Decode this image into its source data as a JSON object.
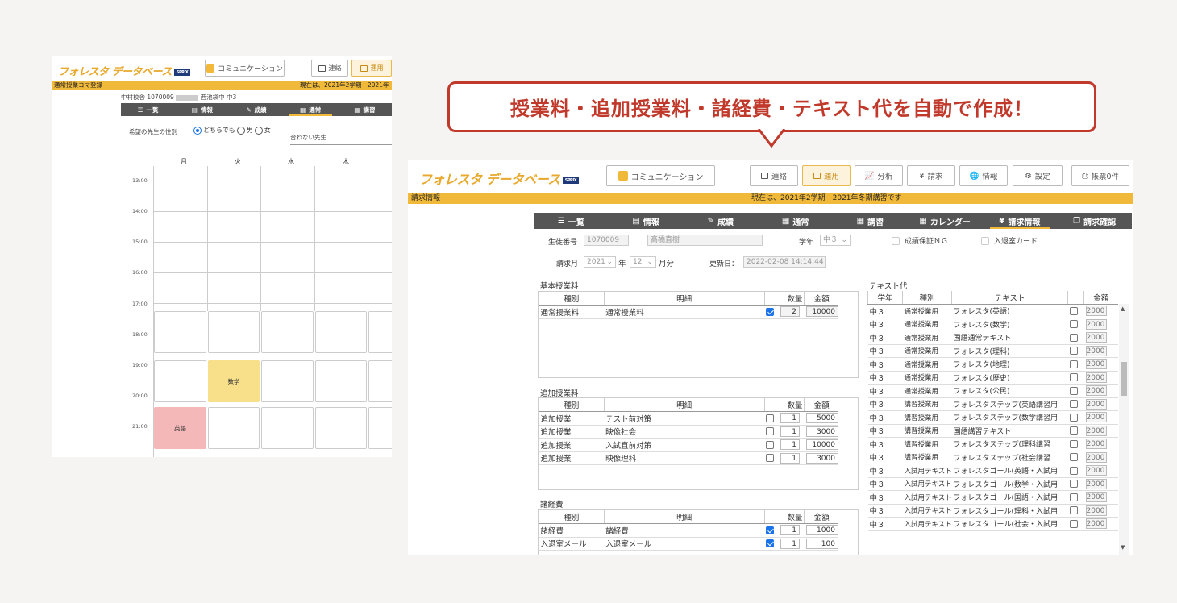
{
  "callout": {
    "text": "授業料・追加授業料・諸経費・テキスト代を自動で作成！"
  },
  "left": {
    "logo": "フォレスタ データベース",
    "sprix": "SPRIX",
    "comm_button": "コミュニケーション",
    "btn_contact": "連絡",
    "btn_ops": "運用",
    "bar_title": "通常授業コマ登録",
    "bar_status": "現在は、2021年2学期　2021年",
    "student_line_a": "中村校舎 1070009",
    "student_line_b": "西池袋中 中3",
    "nav": [
      "一覧",
      "情報",
      "成績",
      "通常",
      "講習"
    ],
    "pref_label": "希望の先生の性別",
    "pref_options": [
      "どちらでも",
      "男",
      "女"
    ],
    "ng_label": "合わない先生",
    "days": [
      "月",
      "火",
      "水",
      "木"
    ],
    "times": [
      "13:00",
      "14:00",
      "15:00",
      "16:00",
      "17:00",
      "18:00",
      "19:00",
      "20:00",
      "21:00"
    ],
    "slot_math": "数学",
    "slot_english": "英語"
  },
  "right": {
    "logo": "フォレスタ データベース",
    "sprix": "SPRIX",
    "comm_button": "コミュニケーション",
    "top_buttons": [
      "連絡",
      "運用",
      "分析",
      "請求",
      "情報",
      "設定",
      "帳票0件"
    ],
    "bar_title": "請求情報",
    "bar_status": "現在は、2021年2学期　2021年冬期講習です",
    "nav": [
      "一覧",
      "情報",
      "成績",
      "通常",
      "講習",
      "カレンダー",
      "請求情報",
      "請求確認"
    ],
    "form": {
      "student_no_label": "生徒番号",
      "student_no": "1070009",
      "student_name": "高橋直樹",
      "grade_label": "学年",
      "grade": "中３",
      "grade_ng_label": "成績保証ＮＧ",
      "entry_card_label": "入退室カード",
      "month_label": "請求月",
      "year": "2021",
      "year_suffix": "年",
      "month": "12",
      "month_suffix": "月分",
      "updated_label": "更新日：",
      "updated": "2022-02-08 14:14:44"
    },
    "basic": {
      "title": "基本授業料",
      "headers": [
        "種別",
        "明細",
        "数量",
        "金額"
      ],
      "rows": [
        {
          "type": "通常授業料",
          "detail": "通常授業料",
          "checked": true,
          "qty": "2",
          "amount": "10000"
        }
      ]
    },
    "extra": {
      "title": "追加授業料",
      "headers": [
        "種別",
        "明細",
        "数量",
        "金額"
      ],
      "rows": [
        {
          "type": "追加授業",
          "detail": "テスト前対策",
          "checked": false,
          "qty": "1",
          "amount": "5000"
        },
        {
          "type": "追加授業",
          "detail": "映像社会",
          "checked": false,
          "qty": "1",
          "amount": "3000"
        },
        {
          "type": "追加授業",
          "detail": "入試直前対策",
          "checked": false,
          "qty": "1",
          "amount": "10000"
        },
        {
          "type": "追加授業",
          "detail": "映像理科",
          "checked": false,
          "qty": "1",
          "amount": "3000"
        }
      ]
    },
    "misc": {
      "title": "諸経費",
      "headers": [
        "種別",
        "明細",
        "数量",
        "金額"
      ],
      "rows": [
        {
          "type": "諸経費",
          "detail": "諸経費",
          "checked": true,
          "qty": "1",
          "amount": "1000"
        },
        {
          "type": "入退室メール",
          "detail": "入退室メール",
          "checked": true,
          "qty": "1",
          "amount": "100"
        }
      ]
    },
    "text": {
      "title": "テキスト代",
      "headers": [
        "学年",
        "種別",
        "テキスト",
        "",
        "金額"
      ],
      "rows": [
        {
          "grade": "中３",
          "type": "通常授業用",
          "text": "フォレスタ(英語)",
          "amount": "2000"
        },
        {
          "grade": "中３",
          "type": "通常授業用",
          "text": "フォレスタ(数学)",
          "amount": "2000"
        },
        {
          "grade": "中３",
          "type": "通常授業用",
          "text": "国語通常テキスト",
          "amount": "2000"
        },
        {
          "grade": "中３",
          "type": "通常授業用",
          "text": "フォレスタ(理科)",
          "amount": "2000"
        },
        {
          "grade": "中３",
          "type": "通常授業用",
          "text": "フォレスタ(地理)",
          "amount": "2000"
        },
        {
          "grade": "中３",
          "type": "通常授業用",
          "text": "フォレスタ(歴史)",
          "amount": "2000"
        },
        {
          "grade": "中３",
          "type": "通常授業用",
          "text": "フォレスタ(公民)",
          "amount": "2000"
        },
        {
          "grade": "中３",
          "type": "講習授業用",
          "text": "フォレスタステップ(英語講習用",
          "amount": "2000"
        },
        {
          "grade": "中３",
          "type": "講習授業用",
          "text": "フォレスタステップ(数学講習用",
          "amount": "2000"
        },
        {
          "grade": "中３",
          "type": "講習授業用",
          "text": "国語講習テキスト",
          "amount": "2000"
        },
        {
          "grade": "中３",
          "type": "講習授業用",
          "text": "フォレスタステップ(理科講習",
          "amount": "2000"
        },
        {
          "grade": "中３",
          "type": "講習授業用",
          "text": "フォレスタステップ(社会講習",
          "amount": "2000"
        },
        {
          "grade": "中３",
          "type": "入試用テキスト",
          "text": "フォレスタゴール(英語・入試用",
          "amount": "2000"
        },
        {
          "grade": "中３",
          "type": "入試用テキスト",
          "text": "フォレスタゴール(数学・入試用",
          "amount": "2000"
        },
        {
          "grade": "中３",
          "type": "入試用テキスト",
          "text": "フォレスタゴール(国語・入試用",
          "amount": "2000"
        },
        {
          "grade": "中３",
          "type": "入試用テキスト",
          "text": "フォレスタゴール(理科・入試用",
          "amount": "2000"
        },
        {
          "grade": "中３",
          "type": "入試用テキスト",
          "text": "フォレスタゴール(社会・入試用",
          "amount": "2000"
        }
      ]
    }
  },
  "colors": {
    "accent": "#f1b93a",
    "callout_border": "#c0392b",
    "callout_text": "#c0392b",
    "nav": "#555555"
  }
}
